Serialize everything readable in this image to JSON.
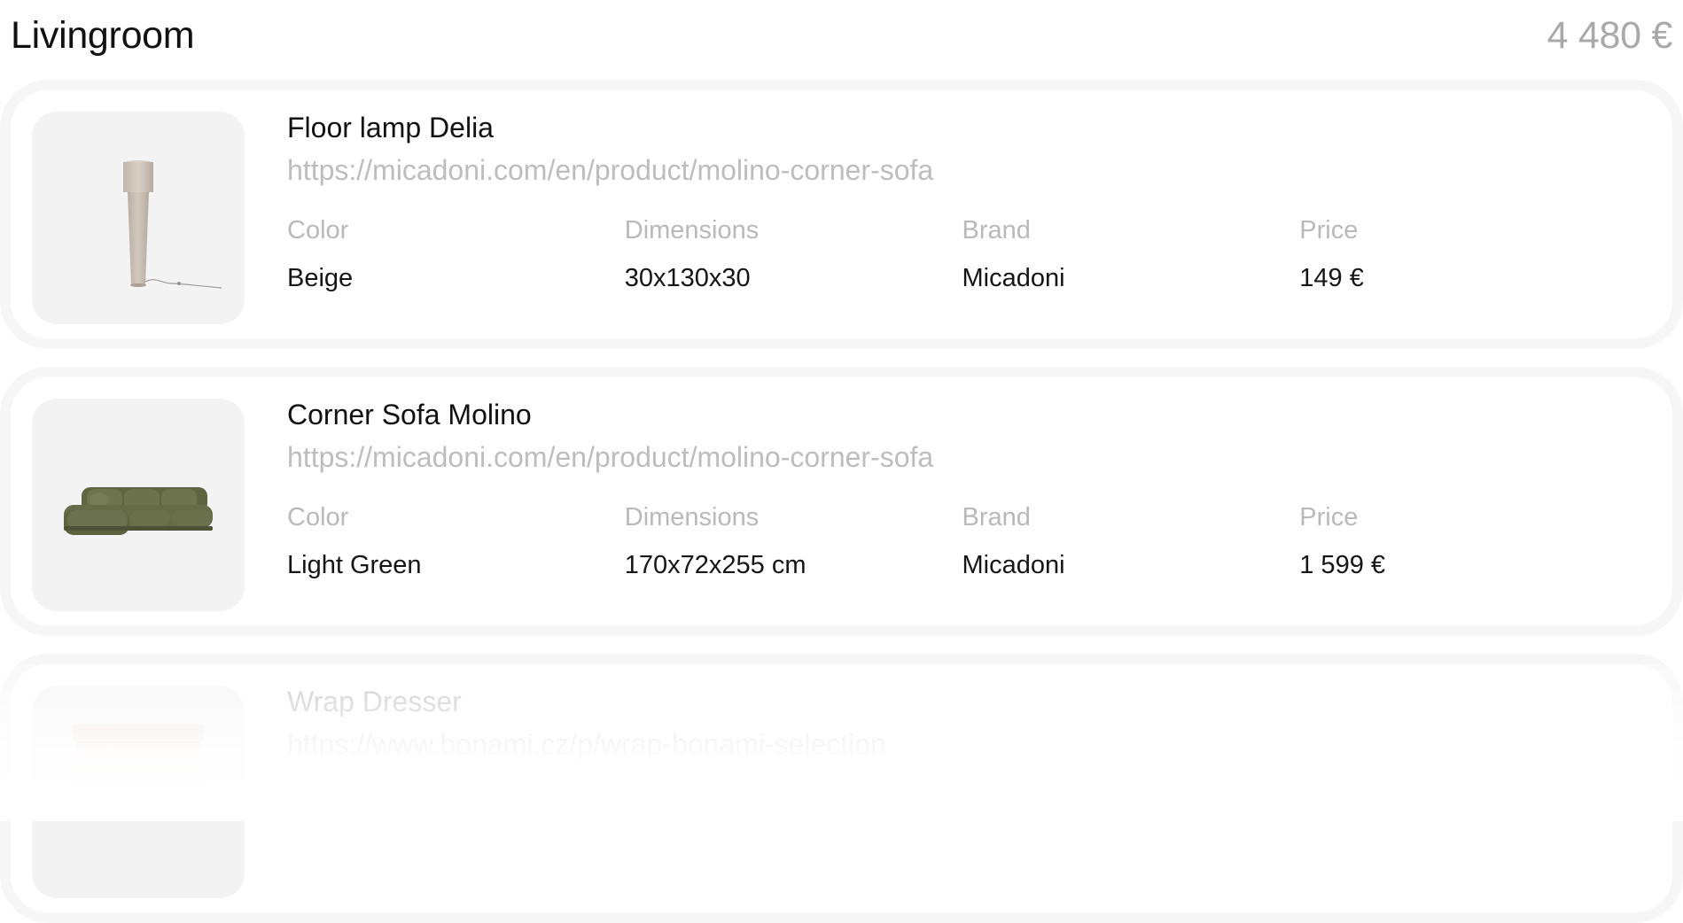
{
  "room": {
    "title": "Livingroom",
    "total": "4 480 €"
  },
  "attribute_labels": {
    "color": "Color",
    "dimensions": "Dimensions",
    "brand": "Brand",
    "price": "Price"
  },
  "products": [
    {
      "name": "Floor lamp Delia",
      "url": "https://micadoni.com/en/product/molino-corner-sofa",
      "color": "Beige",
      "dimensions": "30x130x30",
      "brand": "Micadoni",
      "price": "149 €",
      "image_icon": "floor-lamp-image"
    },
    {
      "name": "Corner Sofa Molino",
      "url": "https://micadoni.com/en/product/molino-corner-sofa",
      "color": "Light Green",
      "dimensions": "170x72x255 cm",
      "brand": "Micadoni",
      "price": "1 599 €",
      "image_icon": "corner-sofa-image"
    },
    {
      "name": "Wrap Dresser",
      "url": "https://www.bonami.cz/p/wrap-bonami-selection",
      "image_icon": "dresser-image"
    }
  ],
  "colors": {
    "card_border": "#f6f6f6",
    "thumb_bg": "#f3f3f3",
    "muted_text": "#b9b9b9",
    "sofa_green": "#6b7049",
    "lamp_beige": "#cfc6bc"
  }
}
